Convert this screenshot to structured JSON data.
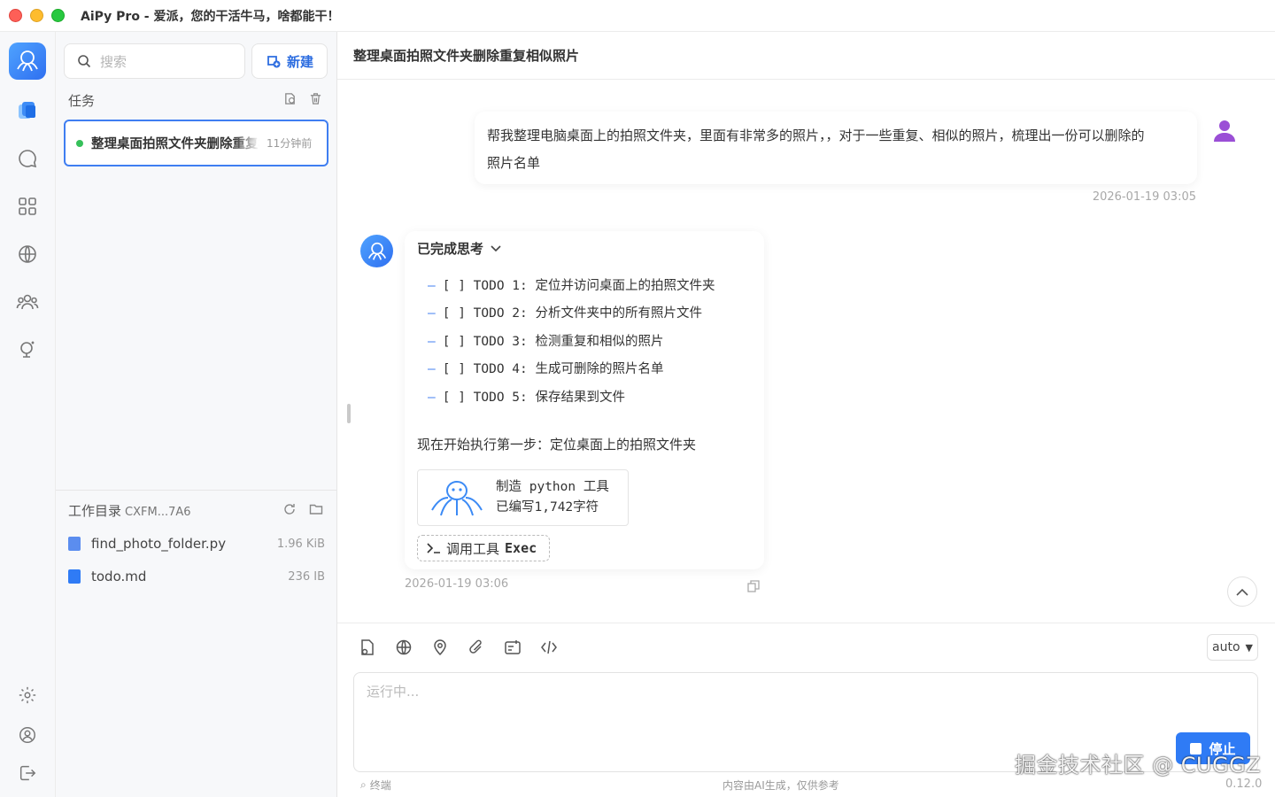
{
  "window": {
    "title": "AiPy Pro - 爱派，您的干活牛马，啥都能干！"
  },
  "sidebar": {
    "search_placeholder": "搜索",
    "new_label": "新建",
    "tasks_header": "任务",
    "tasks": [
      {
        "title": "整理桌面拍照文件夹删除重复相似照片",
        "time": "11分钟前",
        "status": "running"
      }
    ],
    "workdir": {
      "label": "工作目录",
      "name": "CXFM...7A6",
      "files": [
        {
          "name": "find_photo_folder.py",
          "size": "1.96 KiB",
          "type": "python"
        },
        {
          "name": "todo.md",
          "size": "236 IB",
          "type": "markdown"
        }
      ]
    }
  },
  "chat": {
    "title": "整理桌面拍照文件夹删除重复相似照片",
    "user_message": {
      "line1": "帮我整理电脑桌面上的拍照文件夹，里面有非常多的照片，，对于一些重复、相似的照片，梳理出一份可以删除的",
      "line2": "照片名单",
      "timestamp": "2026-01-19 03:05"
    },
    "assistant_message": {
      "thinking_label": "已完成思考",
      "todos": [
        "[ ] TODO 1: 定位并访问桌面上的拍照文件夹",
        "[ ] TODO 2: 分析文件夹中的所有照片文件",
        "[ ] TODO 3: 检测重复和相似的照片",
        "[ ] TODO 4: 生成可删除的照片名单",
        "[ ] TODO 5: 保存结果到文件"
      ],
      "step_text": "现在开始执行第一步：定位桌面上的拍照文件夹",
      "tool": {
        "line1": "制造 python 工具",
        "line2": "已编写1,742字符"
      },
      "exec_label": "调用工具",
      "exec_name": "Exec",
      "timestamp": "2026-01-19 03:06"
    }
  },
  "composer": {
    "model": "auto",
    "placeholder": "运行中...",
    "stop_label": "停止",
    "terminal_label": "终端",
    "disclaimer": "内容由AI生成，仅供参考",
    "version": "0.12.0"
  },
  "watermark": "掘金技术社区 @ CUGGZ",
  "colors": {
    "accent": "#2f7bf5",
    "running": "#36c05a"
  }
}
